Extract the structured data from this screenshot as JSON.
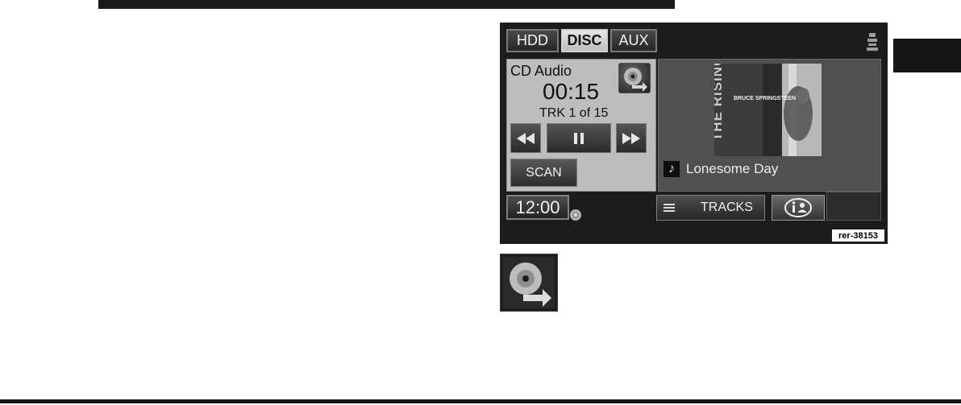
{
  "screen": {
    "sources": [
      {
        "label": "HDD",
        "active": false
      },
      {
        "label": "DISC",
        "active": true
      },
      {
        "label": "AUX",
        "active": false
      }
    ],
    "player": {
      "mode_title": "CD Audio",
      "elapsed_time": "00:15",
      "track_info": "TRK 1 of 15",
      "scan_label": "SCAN"
    },
    "now_playing": {
      "album_artist_text": "BRUCE SPRINGSTEEN",
      "album_title_text": "THE RISING",
      "song_title": "Lonesome Day"
    },
    "footer": {
      "clock": "12:00",
      "tracks_label": "TRACKS"
    },
    "reference_code": "rer-38153"
  },
  "icons": [
    "seat-icon",
    "eject-disc-icon",
    "rewind-icon",
    "pause-icon",
    "fast-forward-icon",
    "music-note-icon",
    "list-icon",
    "info-icon",
    "cd-indicator-icon"
  ]
}
